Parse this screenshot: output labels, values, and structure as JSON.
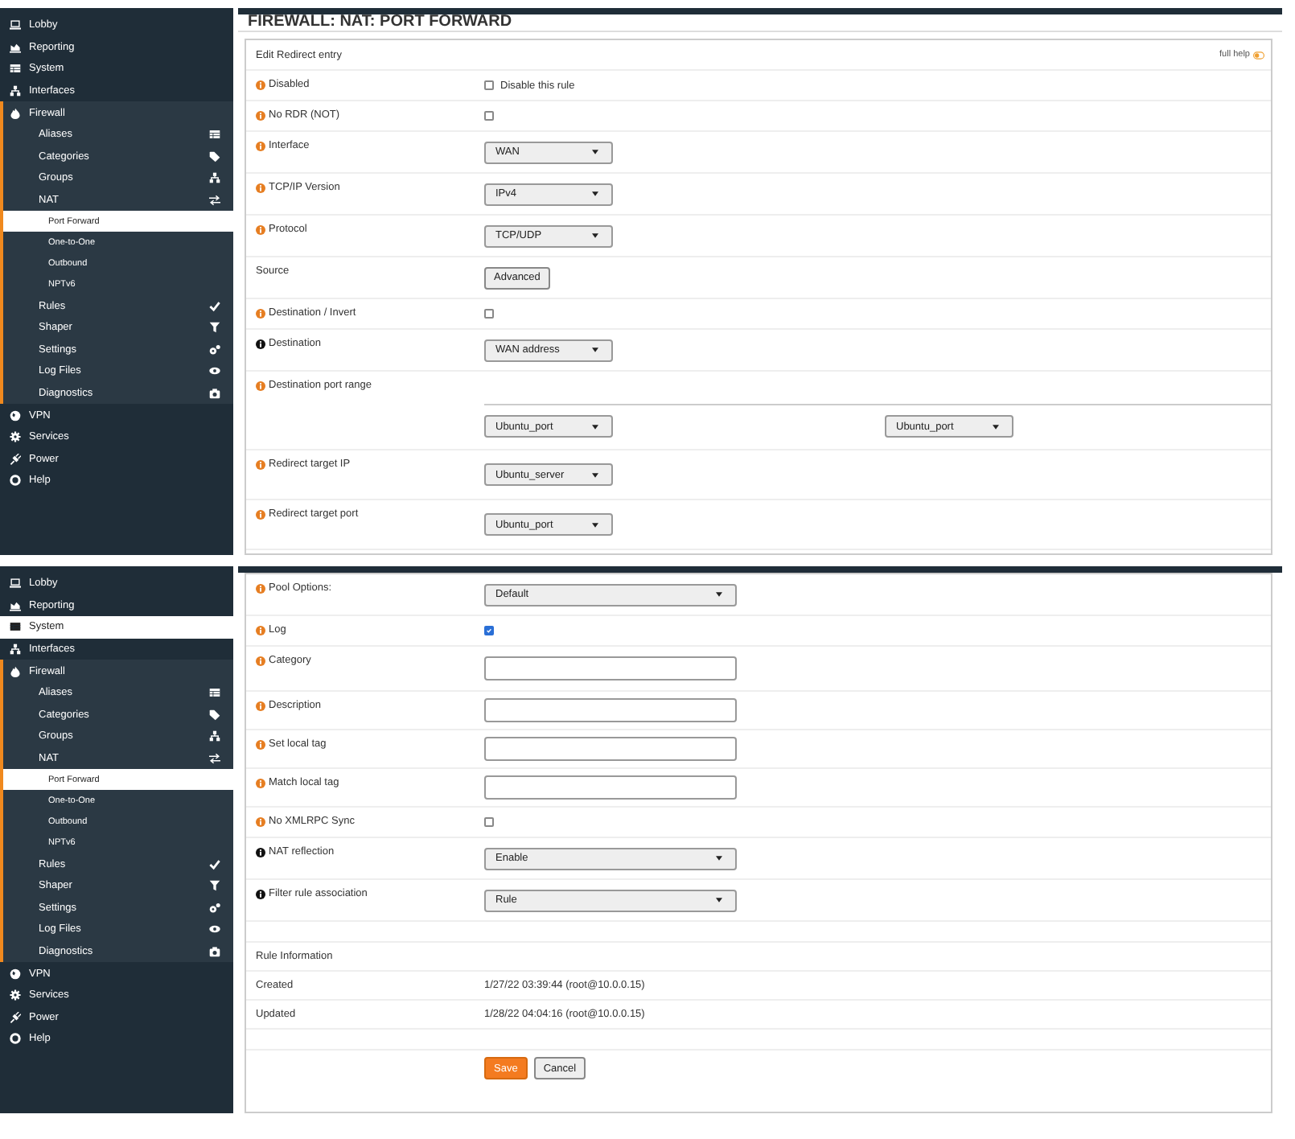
{
  "panels": [
    {
      "menu": [
        {
          "label": "Lobby",
          "selected": false
        },
        {
          "label": "Reporting",
          "selected": false
        },
        {
          "label": "System",
          "selected": false
        },
        {
          "label": "Interfaces",
          "selected": false
        },
        {
          "label": "Firewall",
          "selected": false,
          "expanded": true,
          "children": [
            {
              "label": "Aliases",
              "selected": false
            },
            {
              "label": "Categories",
              "selected": false
            },
            {
              "label": "Groups",
              "selected": false
            },
            {
              "label": "NAT",
              "selected": false,
              "expanded": true,
              "children": [
                {
                  "label": "Port Forward",
                  "selected": true
                },
                {
                  "label": "One-to-One",
                  "selected": false
                },
                {
                  "label": "Outbound",
                  "selected": false
                },
                {
                  "label": "NPTv6",
                  "selected": false
                }
              ]
            },
            {
              "label": "Rules",
              "selected": false
            },
            {
              "label": "Shaper",
              "selected": false
            },
            {
              "label": "Settings",
              "selected": false
            },
            {
              "label": "Log Files",
              "selected": false
            },
            {
              "label": "Diagnostics",
              "selected": false
            }
          ]
        },
        {
          "label": "VPN",
          "selected": false
        },
        {
          "label": "Services",
          "selected": false
        },
        {
          "label": "Power",
          "selected": false
        },
        {
          "label": "Help",
          "selected": false
        }
      ],
      "title": "FIREWALL: NAT: PORT FORWARD",
      "header": {
        "title": "Edit Redirect entry",
        "help": "full help"
      },
      "rows": [
        {
          "kind": "checkbox",
          "label": "Disabled",
          "color": "#e67e22",
          "checked": false,
          "text": "Disable this rule"
        },
        {
          "kind": "checkbox",
          "label": "No RDR (NOT)",
          "color": "#e67e22",
          "checked": false
        },
        {
          "kind": "select",
          "label": "Interface",
          "color": "#e67e22",
          "value": "WAN"
        },
        {
          "kind": "select",
          "label": "TCP/IP Version",
          "color": "#e67e22",
          "value": "IPv4"
        },
        {
          "kind": "select",
          "label": "Protocol",
          "color": "#e67e22",
          "value": "TCP/UDP"
        },
        {
          "kind": "button",
          "label": "Source",
          "value": "Advanced"
        },
        {
          "kind": "checkbox",
          "label": "Destination / Invert",
          "color": "#e67e22",
          "checked": false
        },
        {
          "kind": "select",
          "label": "Destination",
          "color": "#111111",
          "value": "WAN address"
        },
        {
          "kind": "port-range",
          "label": "Destination port range",
          "color": "#e67e22",
          "from": "Ubuntu_port",
          "to": "Ubuntu_port"
        },
        {
          "kind": "select",
          "label": "Redirect target IP",
          "color": "#e67e22",
          "value": "Ubuntu_server"
        },
        {
          "kind": "select",
          "label": "Redirect target port",
          "color": "#e67e22",
          "value": "Ubuntu_port"
        }
      ]
    },
    {
      "menu": [
        {
          "label": "Lobby",
          "selected": false
        },
        {
          "label": "Reporting",
          "selected": false
        },
        {
          "label": "System",
          "selected": true
        },
        {
          "label": "Interfaces",
          "selected": false
        },
        {
          "label": "Firewall",
          "selected": false,
          "expanded": true,
          "children": [
            {
              "label": "Aliases",
              "selected": false
            },
            {
              "label": "Categories",
              "selected": false
            },
            {
              "label": "Groups",
              "selected": false
            },
            {
              "label": "NAT",
              "selected": false,
              "expanded": true,
              "children": [
                {
                  "label": "Port Forward",
                  "selected": true
                },
                {
                  "label": "One-to-One",
                  "selected": false
                },
                {
                  "label": "Outbound",
                  "selected": false
                },
                {
                  "label": "NPTv6",
                  "selected": false
                }
              ]
            },
            {
              "label": "Rules",
              "selected": false
            },
            {
              "label": "Shaper",
              "selected": false
            },
            {
              "label": "Settings",
              "selected": false
            },
            {
              "label": "Log Files",
              "selected": false
            },
            {
              "label": "Diagnostics",
              "selected": false
            }
          ]
        },
        {
          "label": "VPN",
          "selected": false
        },
        {
          "label": "Services",
          "selected": false
        },
        {
          "label": "Power",
          "selected": false
        },
        {
          "label": "Help",
          "selected": false
        }
      ],
      "rows": [
        {
          "kind": "wide-select",
          "label": "Pool Options:",
          "color": "#e67e22",
          "value": "Default"
        },
        {
          "kind": "checkbox",
          "label": "Log",
          "color": "#e67e22",
          "checked": true
        },
        {
          "kind": "input",
          "label": "Category",
          "color": "#e67e22"
        },
        {
          "kind": "input",
          "label": "Description",
          "color": "#e67e22"
        },
        {
          "kind": "input",
          "label": "Set local tag",
          "color": "#e67e22"
        },
        {
          "kind": "input",
          "label": "Match local tag",
          "color": "#e67e22"
        },
        {
          "kind": "checkbox",
          "label": "No XMLRPC Sync",
          "color": "#e67e22",
          "checked": false
        },
        {
          "kind": "wide-select",
          "label": "NAT reflection",
          "color": "#111111",
          "value": "Enable"
        },
        {
          "kind": "wide-select",
          "label": "Filter rule association",
          "color": "#111111",
          "value": "Rule"
        },
        {
          "kind": "blank"
        },
        {
          "kind": "section",
          "label": "Rule Information"
        },
        {
          "kind": "info",
          "label": "Created",
          "value": "1/27/22 03:39:44 (root@10.0.0.15)"
        },
        {
          "kind": "info",
          "label": "Updated",
          "value": "1/28/22 04:04:16 (root@10.0.0.15)"
        },
        {
          "kind": "blank"
        },
        {
          "kind": "actions",
          "buttons": [
            {
              "label": "Save",
              "kind": "primary"
            },
            {
              "label": "Cancel",
              "kind": "default"
            }
          ]
        }
      ]
    }
  ]
}
